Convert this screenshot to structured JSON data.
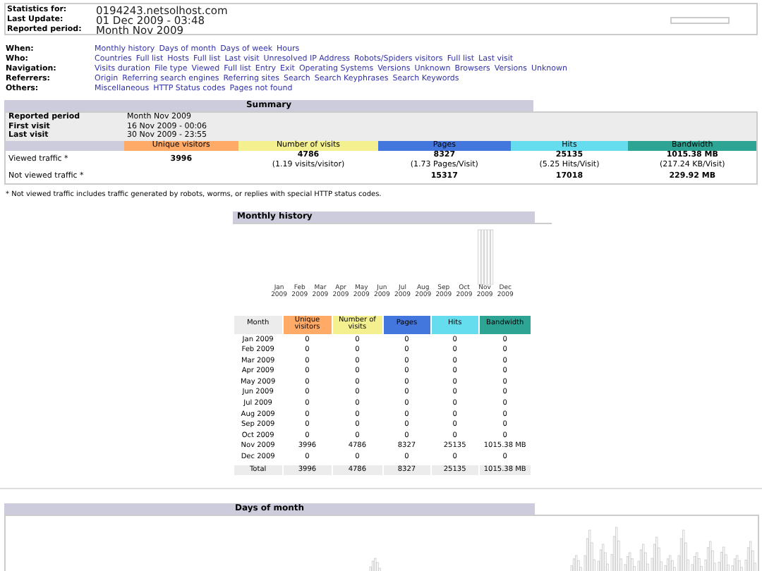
{
  "header": {
    "rows": [
      {
        "label": "Statistics for:",
        "value": "0194243.netsolhost.com"
      },
      {
        "label": "Last Update:",
        "value": "01 Dec 2009 - 03:48"
      },
      {
        "label": "Reported period:",
        "value": "Month Nov 2009"
      }
    ]
  },
  "nav": [
    {
      "label": "When:",
      "links": [
        "Monthly history",
        "Days of month",
        "Days of week",
        "Hours"
      ]
    },
    {
      "label": "Who:",
      "links": [
        "Countries",
        "Full list",
        "Hosts",
        "Full list",
        "Last visit",
        "Unresolved IP Address",
        "Robots/Spiders visitors",
        "Full list",
        "Last visit"
      ]
    },
    {
      "label": "Navigation:",
      "links": [
        "Visits duration",
        "File type",
        "Viewed",
        "Full list",
        "Entry",
        "Exit",
        "Operating Systems",
        "Versions",
        "Unknown",
        "Browsers",
        "Versions",
        "Unknown"
      ]
    },
    {
      "label": "Referrers:",
      "links": [
        "Origin",
        "Referring search engines",
        "Referring sites",
        "Search",
        "Search Keyphrases",
        "Search Keywords"
      ]
    },
    {
      "label": "Others:",
      "links": [
        "Miscellaneous",
        "HTTP Status codes",
        "Pages not found"
      ]
    }
  ],
  "summary": {
    "title": "Summary",
    "period_rows": [
      {
        "label": "Reported period",
        "value": "Month Nov 2009"
      },
      {
        "label": "First visit",
        "value": "16 Nov 2009 - 00:06"
      },
      {
        "label": "Last visit",
        "value": "30 Nov 2009 - 23:55"
      }
    ],
    "columns": [
      {
        "label": "Unique visitors",
        "color": "#ffaa66"
      },
      {
        "label": "Number of visits",
        "color": "#f4f090"
      },
      {
        "label": "Pages",
        "color": "#4477dd"
      },
      {
        "label": "Hits",
        "color": "#66ddee"
      },
      {
        "label": "Bandwidth",
        "color": "#2ea495"
      }
    ],
    "rows": [
      {
        "label": "Viewed traffic *",
        "cells": [
          {
            "value": "3996"
          },
          {
            "value": "4786",
            "detail": "(1.19 visits/visitor)"
          },
          {
            "value": "8327",
            "detail": "(1.73 Pages/Visit)"
          },
          {
            "value": "25135",
            "detail": "(5.25 Hits/Visit)"
          },
          {
            "value": "1015.38 MB",
            "detail": "(217.24 KB/Visit)"
          }
        ]
      },
      {
        "label": "Not viewed traffic *",
        "cells": [
          null,
          null,
          {
            "value": "15317"
          },
          {
            "value": "17018"
          },
          {
            "value": "229.92 MB"
          }
        ]
      }
    ],
    "footnote": "* Not viewed traffic includes traffic generated by robots, worms, or replies with special HTTP status codes."
  },
  "monthly": {
    "title": "Monthly history",
    "chart_months": [
      {
        "month": "Jan",
        "year": "2009"
      },
      {
        "month": "Feb",
        "year": "2009"
      },
      {
        "month": "Mar",
        "year": "2009"
      },
      {
        "month": "Apr",
        "year": "2009"
      },
      {
        "month": "May",
        "year": "2009"
      },
      {
        "month": "Jun",
        "year": "2009"
      },
      {
        "month": "Jul",
        "year": "2009"
      },
      {
        "month": "Aug",
        "year": "2009"
      },
      {
        "month": "Sep",
        "year": "2009"
      },
      {
        "month": "Oct",
        "year": "2009"
      },
      {
        "month": "Nov",
        "year": "2009"
      },
      {
        "month": "Dec",
        "year": "2009"
      }
    ],
    "columns": [
      {
        "label": "Month"
      },
      {
        "label": "Unique visitors",
        "color": "#ffaa66"
      },
      {
        "label": "Number of visits",
        "color": "#f4f090"
      },
      {
        "label": "Pages",
        "color": "#4477dd"
      },
      {
        "label": "Hits",
        "color": "#66ddee"
      },
      {
        "label": "Bandwidth",
        "color": "#2ea495"
      }
    ],
    "rows": [
      [
        "Jan 2009",
        "0",
        "0",
        "0",
        "0",
        "0"
      ],
      [
        "Feb 2009",
        "0",
        "0",
        "0",
        "0",
        "0"
      ],
      [
        "Mar 2009",
        "0",
        "0",
        "0",
        "0",
        "0"
      ],
      [
        "Apr 2009",
        "0",
        "0",
        "0",
        "0",
        "0"
      ],
      [
        "May 2009",
        "0",
        "0",
        "0",
        "0",
        "0"
      ],
      [
        "Jun 2009",
        "0",
        "0",
        "0",
        "0",
        "0"
      ],
      [
        "Jul 2009",
        "0",
        "0",
        "0",
        "0",
        "0"
      ],
      [
        "Aug 2009",
        "0",
        "0",
        "0",
        "0",
        "0"
      ],
      [
        "Sep 2009",
        "0",
        "0",
        "0",
        "0",
        "0"
      ],
      [
        "Oct 2009",
        "0",
        "0",
        "0",
        "0",
        "0"
      ],
      [
        "Nov 2009",
        "3996",
        "4786",
        "8327",
        "25135",
        "1015.38 MB"
      ],
      [
        "Dec 2009",
        "0",
        "0",
        "0",
        "0",
        "0"
      ]
    ],
    "total": [
      "Total",
      "3996",
      "4786",
      "8327",
      "25135",
      "1015.38 MB"
    ]
  },
  "days": {
    "title": "Days of month"
  }
}
